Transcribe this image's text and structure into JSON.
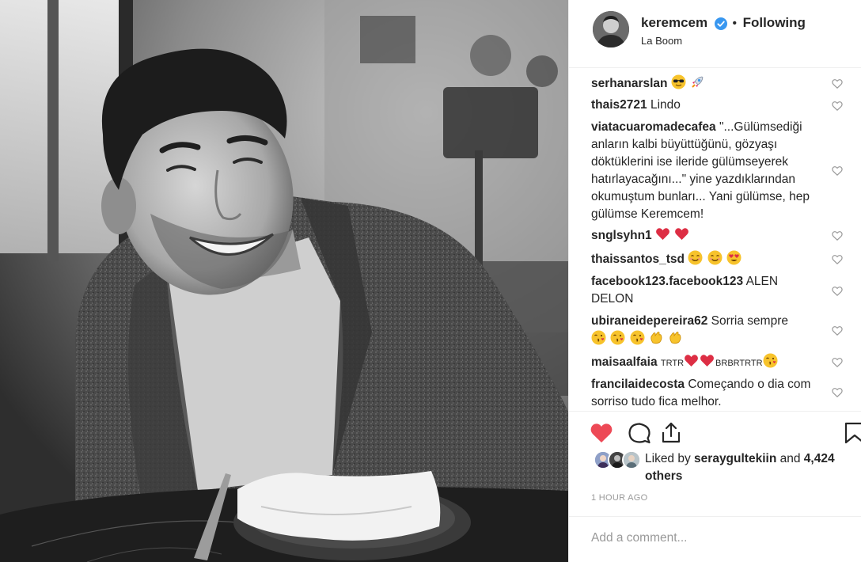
{
  "post": {
    "username": "keremcem",
    "separator": "•",
    "follow_label": "Following",
    "location": "La Boom",
    "verified": true
  },
  "comments": [
    {
      "user": "serhanarslan",
      "text": "",
      "emoji": [
        "sunglasses-emoji",
        "rocket-emoji"
      ]
    },
    {
      "user": "thais2721",
      "text": "Lindo",
      "emoji": []
    },
    {
      "user": "viatacuaromadecafea",
      "text": "\"...Gülümsediği anların kalbi büyüttüğünü, gözyaşı döktüklerini ise ileride gülümseyerek hatırlayacağını...\" yine yazdıklarından okumuştum bunları... Yani gülümse, hep gülümse Keremcem!",
      "emoji": []
    },
    {
      "user": "snglsyhn1",
      "text": "",
      "emoji": [
        "red-heart-emoji",
        "red-heart-emoji"
      ]
    },
    {
      "user": "thaissantos_tsd",
      "text": "",
      "emoji": [
        "smiling-blush-emoji",
        "smiling-blush-emoji",
        "heart-eyes-emoji"
      ]
    },
    {
      "user": "facebook123.facebook123",
      "text": "ALEN DELON",
      "emoji": []
    },
    {
      "user": "ubiraneidepereira62",
      "text": "Sorria sempre",
      "emoji": [
        "kiss-emoji",
        "kiss-emoji",
        "kiss-emoji",
        "clap-emoji",
        "clap-emoji"
      ]
    },
    {
      "user": "maisaalfaia",
      "text_parts": [
        "TRTR",
        "BRBRTRTR"
      ],
      "emoji": [
        "red-heart-emoji",
        "red-heart-emoji",
        "kiss-emoji"
      ]
    },
    {
      "user": "francilaidecosta",
      "text": "Começando o dia com sorriso tudo fica melhor.",
      "emoji": []
    }
  ],
  "likes": {
    "prefix": "Liked by",
    "liker": "seraygultekiin",
    "and": "and",
    "others": "4,424 others"
  },
  "time_ago": "1 HOUR AGO",
  "add_comment_placeholder": "Add a comment...",
  "colors": {
    "like_red": "#ed4956",
    "verified_blue": "#3897f0",
    "text": "#262626",
    "muted": "#999999",
    "divider": "#efefef"
  },
  "icons": {
    "like": "heart-filled-icon",
    "comment": "speech-bubble-icon",
    "share": "share-arrow-icon",
    "save": "bookmark-icon",
    "comment_like": "heart-outline-icon"
  }
}
